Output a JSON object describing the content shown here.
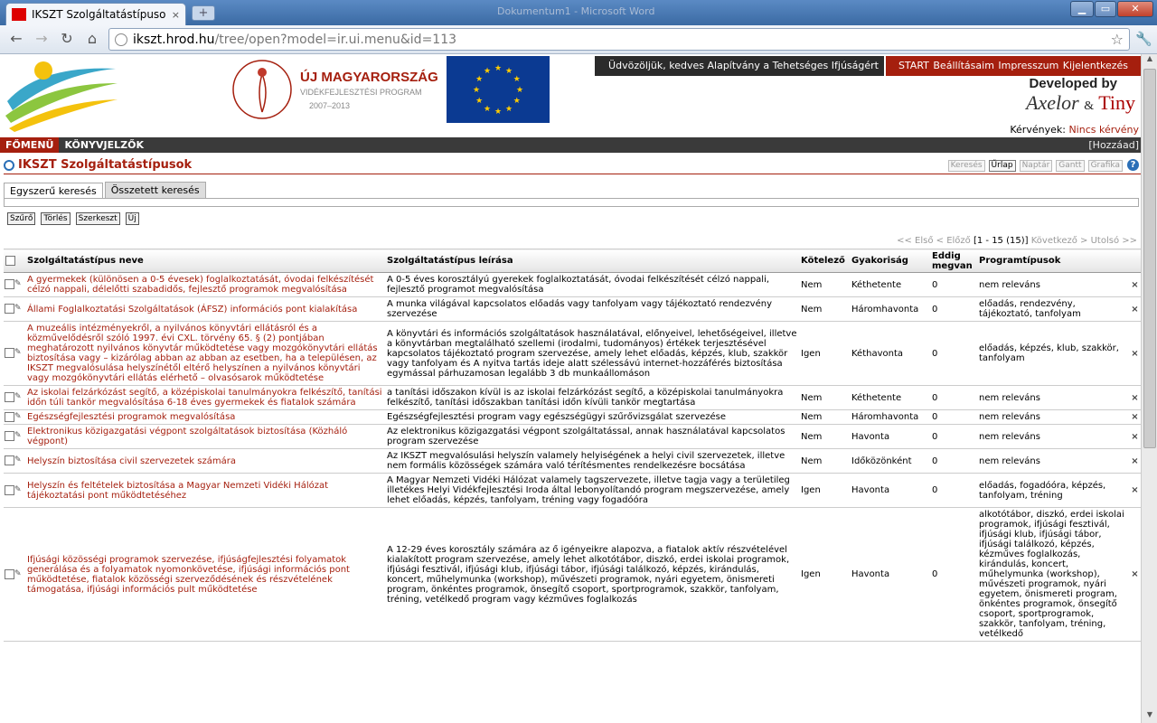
{
  "browser": {
    "tab_title": "IKSZT Szolgáltatástípusok",
    "tab_close": "×",
    "new_tab": "+",
    "window_title": "Dokumentum1 - Microsoft Word",
    "url_host": "ikszt.hrod.hu",
    "url_path": "/tree/open?model=ir.ui.menu&id=113",
    "back": "←",
    "forward": "→",
    "reload": "↻",
    "home": "⌂",
    "star": "☆",
    "wrench": "🔧",
    "min": "▁",
    "max": "▭",
    "close": "✕"
  },
  "header": {
    "umvp_title": "ÚJ MAGYARORSZÁG",
    "umvp_sub": "VIDÉKFEJLESZTÉSI PROGRAM",
    "umvp_years": "2007–2013",
    "welcome": "Üdvözöljük, kedves Alapítvány a Tehetséges Ifjúságért",
    "menu_links": "START  Beállításaim  Impresszum  Kijelentkezés",
    "developed_by": "Developed by",
    "axelor": "Axelor",
    "amp": "&",
    "tiny": "Tiny",
    "requests_label": "Kérvények:",
    "requests_value": "Nincs kérvény"
  },
  "menubar": {
    "main": "FŐMENÜ",
    "bookmarks": "KÖNYVJELZŐK",
    "add": "[Hozzáad]"
  },
  "page": {
    "title": "IKSZT Szolgáltatástípusok",
    "view_buttons": [
      "Keresés",
      "Űrlap",
      "Naptár",
      "Gantt",
      "Grafika"
    ],
    "help": "?",
    "search_tabs": [
      "Egyszerű keresés",
      "Összetett keresés"
    ],
    "filter_buttons": [
      "Szűrő",
      "Törlés",
      "Szerkeszt",
      "Új"
    ],
    "pager": {
      "first": "<< Első",
      "prev": "< Előző",
      "range": "[1 - 15 (15)]",
      "next": "Következő >",
      "last": "Utolsó >>"
    }
  },
  "table": {
    "columns": [
      "Szolgáltatástípus neve",
      "Szolgáltatástípus leírása",
      "Kötelező",
      "Gyakoriság",
      "Eddig megvan",
      "Programtípusok"
    ],
    "rows": [
      {
        "name": "A gyermekek (különösen a 0-5 évesek) foglalkoztatását, óvodai felkészítését célzó nappali, délelőtti szabadidős, fejlesztő programok megvalósítása",
        "desc": "A 0-5 éves korosztályú gyerekek foglalkoztatását, óvodai felkészítését célzó nappali, fejlesztő programot megvalósítása",
        "required": "Nem",
        "freq": "Kéthetente",
        "count": "0",
        "types": "nem releváns"
      },
      {
        "name": "Állami Foglalkoztatási Szolgáltatások (ÁFSZ) információs pont kialakítása",
        "desc": "A munka világával kapcsolatos előadás vagy tanfolyam vagy tájékoztató rendezvény szervezése",
        "required": "Nem",
        "freq": "Háromhavonta",
        "count": "0",
        "types": "előadás, rendezvény, tájékoztató, tanfolyam"
      },
      {
        "name": "A muzeális intézményekről, a nyilvános könyvtári ellátásról és a közművelődésről szóló 1997. évi CXL. törvény 65. § (2) pontjában meghatározott nyilvános könyvtár működtetése vagy mozgókönyvtári ellátás biztosítása vagy – kizárólag abban az abban az esetben, ha a településen, az IKSZT megvalósulása helyszínétől eltérő helyszínen a nyilvános könyvtári vagy mozgókönyvtári ellátás elérhető – olvasósarok működtetése",
        "desc": "A könyvtári és információs szolgáltatások használatával, előnyeivel, lehetőségeivel, illetve a könyvtárban megtalálható szellemi (irodalmi, tudományos) értékek terjesztésével kapcsolatos tájékoztató program szervezése, amely lehet előadás, képzés, klub, szakkör vagy tanfolyam és A nyitva tartás ideje alatt szélessávú internet-hozzáférés biztosítása egymással párhuzamosan legalább 3 db munkaállomáson",
        "required": "Igen",
        "freq": "Kéthavonta",
        "count": "0",
        "types": "előadás, képzés, klub, szakkör, tanfolyam"
      },
      {
        "name": "Az iskolai felzárkózást segítő, a középiskolai tanulmányokra felkészítő, tanítási időn túli tankör megvalósítása 6-18 éves gyermekek és fiatalok számára",
        "desc": "a tanítási időszakon kívül is az iskolai felzárkózást segítő, a középiskolai tanulmányokra felkészítő, tanítási időszakban tanítási időn kívüli tankör megtartása",
        "required": "Nem",
        "freq": "Kéthetente",
        "count": "0",
        "types": "nem releváns"
      },
      {
        "name": "Egészségfejlesztési programok megvalósítása",
        "desc": "Egészségfejlesztési program vagy egészségügyi szűrővizsgálat szervezése",
        "required": "Nem",
        "freq": "Háromhavonta",
        "count": "0",
        "types": "nem releváns"
      },
      {
        "name": "Elektronikus közigazgatási végpont szolgáltatások biztosítása (Közháló végpont)",
        "desc": "Az elektronikus közigazgatási végpont szolgáltatással, annak használatával kapcsolatos program szervezése",
        "required": "Nem",
        "freq": "Havonta",
        "count": "0",
        "types": "nem releváns"
      },
      {
        "name": "Helyszín biztosítása civil szervezetek számára",
        "desc": "Az IKSZT megvalósulási helyszín valamely helyiségének a helyi civil szervezetek, illetve nem formális közösségek számára való térítésmentes rendelkezésre bocsátása",
        "required": "Nem",
        "freq": "Időközönként",
        "count": "0",
        "types": "nem releváns"
      },
      {
        "name": "Helyszín és feltételek biztosítása a Magyar Nemzeti Vidéki Hálózat tájékoztatási pont működtetéséhez",
        "desc": "A Magyar Nemzeti Vidéki Hálózat valamely tagszervezete, illetve tagja vagy a területileg illetékes Helyi Vidékfejlesztési Iroda által lebonyolítandó program megszervezése, amely lehet előadás, képzés, tanfolyam, tréning vagy fogadóóra",
        "required": "Igen",
        "freq": "Havonta",
        "count": "0",
        "types": "előadás, fogadóóra, képzés, tanfolyam, tréning"
      },
      {
        "name": "Ifjúsági közösségi programok szervezése, ifjúságfejlesztési folyamatok generálása és a folyamatok nyomonkövetése, ifjúsági információs pont működtetése, fiatalok közösségi szerveződésének és részvételének támogatása, ifjúsági információs pult működtetése",
        "desc": "A 12-29 éves korosztály számára az ő igényeikre alapozva, a fiatalok aktív részvételével kialakított program szervezése, amely lehet alkotótábor, diszkó, erdei iskolai programok, ifjúsági fesztivál, ifjúsági klub, ifjúsági tábor, ifjúsági találkozó, képzés, kirándulás, koncert, műhelymunka (workshop), művészeti programok, nyári egyetem, önismereti program, önkéntes programok, önsegítő csoport, sportprogramok, szakkör, tanfolyam, tréning, vetélkedő program vagy kézműves foglalkozás",
        "required": "Igen",
        "freq": "Havonta",
        "count": "0",
        "types": "alkotótábor, diszkó, erdei iskolai programok, ifjúsági fesztivál, ifjúsági klub, ifjúsági tábor, ifjúsági találkozó, képzés, kézműves foglalkozás, kirándulás, koncert, műhelymunka (workshop), művészeti programok, nyári egyetem, önismereti program, önkéntes programok, önsegítő csoport, sportprogramok, szakkör, tanfolyam, tréning, vetélkedő"
      }
    ]
  }
}
